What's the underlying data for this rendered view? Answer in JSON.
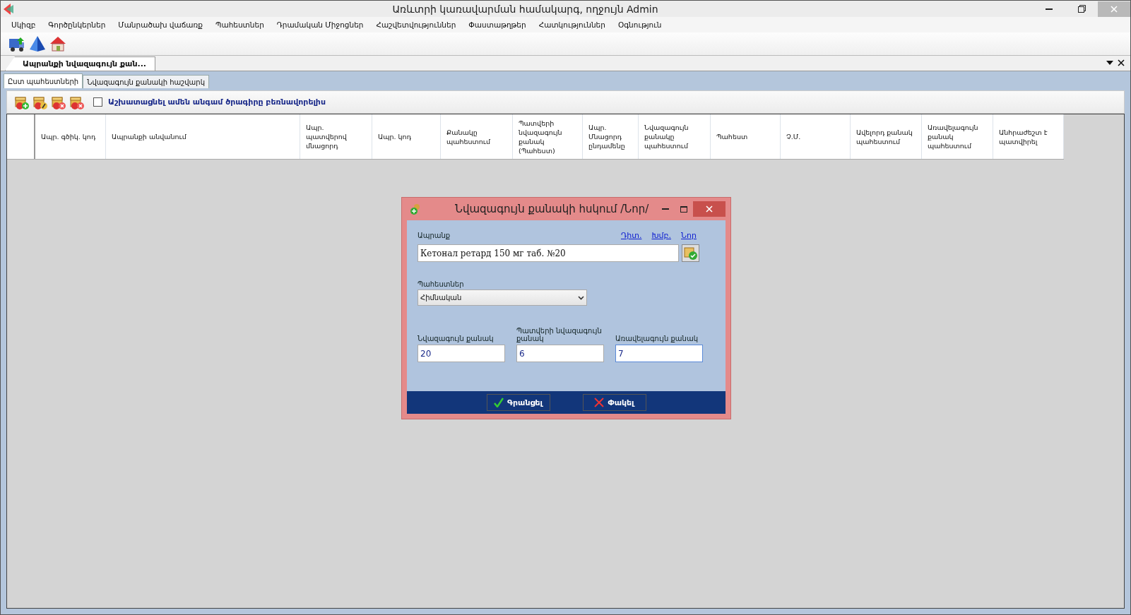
{
  "window": {
    "title": "Առևտրի կառավարման համակարգ, ողջույն Admin"
  },
  "menu": [
    "Սկիզբ",
    "Գործընկերներ",
    "Մանրածախ վաճառք",
    "Պահեստներ",
    "Դրամական Միջոցներ",
    "Հաշվետվություններ",
    "Փաստաթղթեր",
    "Հատկություններ",
    "Օգնություն"
  ],
  "document_tabs": [
    {
      "label": "Ապրանքի նվազագույն քան...",
      "selected": true
    }
  ],
  "sub_tabs": [
    {
      "label": "Ըստ պահեստների",
      "selected": true
    },
    {
      "label": "Նվազագույն քանակի հաշվարկ",
      "selected": false
    }
  ],
  "toolbar": {
    "checkbox": {
      "label": "Աշխատացնել ամեն անգամ ծրագիրը բեռնավորելիս",
      "checked": false
    }
  },
  "table": {
    "columns": [
      "Ապր. գծիկ. կոդ",
      "Ապրանքի անվանում",
      "Ապր. պատվերով մնացորդ",
      "Ապր. կոդ",
      "Քանակը պահեստում",
      "Պատվերի նվազագույն քանակ (Պահեստ)",
      "Ապր. Մնացորդ ընդամենը",
      "Նվազագույն քանակը պահեստում",
      "Պահեստ",
      "Չ.Մ.",
      "Ավելորդ քանակ պահեստում",
      "Առավելագույն քանակ պահեստում",
      "Անհրաժեշտ է պատվիրել"
    ]
  },
  "dialog": {
    "title": "Նվազագույն քանակի հսկում /Նոր/",
    "product_label": "Ապրանք",
    "links": [
      "Դիտ.",
      "Խմբ.",
      "Նոր"
    ],
    "product_value": "Кетонал ретард 150 мг таб. №20",
    "warehouse_label": "Պահեստներ",
    "warehouse_value": "Հիմնական",
    "fields": [
      {
        "label": "Նվազագույն քանակ",
        "value": "20",
        "focused": false
      },
      {
        "label": "Պատվերի նվազագույն քանակ",
        "value": "6",
        "focused": false
      },
      {
        "label": "Առավելագույն քանակ",
        "value": "7",
        "focused": true
      }
    ],
    "buttons": [
      {
        "label": "Գրանցել",
        "kind": "ok"
      },
      {
        "label": "Փակել",
        "kind": "cancel"
      }
    ]
  }
}
